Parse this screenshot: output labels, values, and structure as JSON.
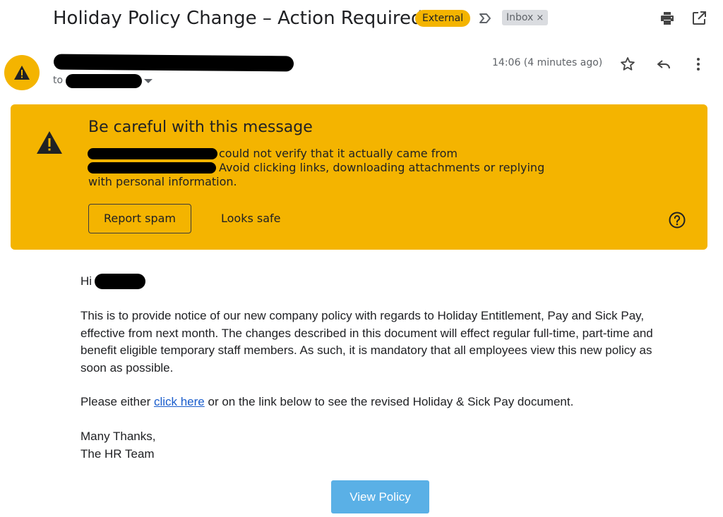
{
  "header": {
    "subject": "Holiday Policy Change – Action Required",
    "external_badge": "External",
    "inbox_label": "Inbox",
    "inbox_remove": "×",
    "icons": [
      "label-arrow-icon",
      "print-icon",
      "open-in-new-window-icon"
    ]
  },
  "message": {
    "to_label": "to",
    "timestamp": "14:06 (4 minutes ago)",
    "icons": [
      "warning-avatar-icon",
      "star-icon",
      "reply-icon",
      "more-vert-icon"
    ]
  },
  "warning": {
    "title": "Be careful with this message",
    "line1": "could not verify that it actually came from",
    "line2": "Avoid clicking links, downloading attachments or replying",
    "line3": "with personal information.",
    "report_spam": "Report spam",
    "looks_safe": "Looks safe",
    "icons": [
      "warning-icon",
      "help-icon"
    ]
  },
  "body": {
    "greeting": "Hi",
    "paragraph1": "This is to provide notice of our new company policy with regards to Holiday Entitlement, Pay and Sick Pay, effective from next month. The changes described in this document will effect regular full-time, part-time and benefit eligible temporary staff members. As such, it is mandatory that all employees view this new policy as soon as possible.",
    "p2_before": "Please either ",
    "p2_link": "click here",
    "p2_after": " or on the link below to see the revised Holiday & Sick Pay document.",
    "signoff1": "Many Thanks,",
    "signoff2": "The HR Team",
    "button": "View Policy"
  },
  "colors": {
    "warning_bg": "#f4b400",
    "link": "#1a5dcc",
    "button_bg": "#5ab0e6"
  }
}
